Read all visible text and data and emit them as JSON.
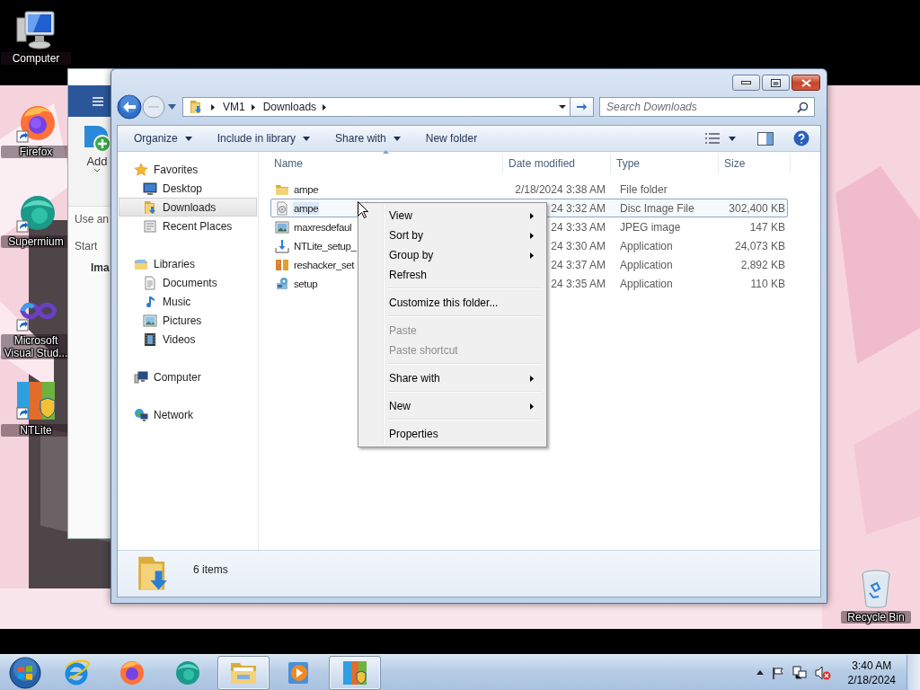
{
  "desktop": {
    "icons": [
      {
        "label": "Computer"
      },
      {
        "label": "Firefox"
      },
      {
        "label": "Supermium"
      },
      {
        "label": "Microsoft Visual Stud..."
      },
      {
        "label": "NTLite"
      },
      {
        "label": "Recycle Bin"
      }
    ]
  },
  "back_window": {
    "button": "Add",
    "texts": [
      "Use an",
      "Start",
      "Ima"
    ]
  },
  "explorer": {
    "address": {
      "crumbs": [
        "VM1",
        "Downloads"
      ]
    },
    "search": {
      "placeholder": "Search Downloads"
    },
    "commands": [
      {
        "label": "Organize",
        "dropdown": true
      },
      {
        "label": "Include in library",
        "dropdown": true
      },
      {
        "label": "Share with",
        "dropdown": true
      },
      {
        "label": "New folder",
        "dropdown": false
      }
    ],
    "nav": [
      {
        "label": "Favorites",
        "selected": false,
        "children": [
          {
            "label": "Desktop",
            "selected": false
          },
          {
            "label": "Downloads",
            "selected": true
          },
          {
            "label": "Recent Places",
            "selected": false
          }
        ]
      },
      {
        "label": "Libraries",
        "selected": false,
        "children": [
          {
            "label": "Documents",
            "selected": false
          },
          {
            "label": "Music",
            "selected": false
          },
          {
            "label": "Pictures",
            "selected": false
          },
          {
            "label": "Videos",
            "selected": false
          }
        ]
      },
      {
        "label": "Computer",
        "selected": false
      },
      {
        "label": "Network",
        "selected": false
      }
    ],
    "columns": [
      "Name",
      "Date modified",
      "Type",
      "Size"
    ],
    "files": [
      {
        "name": "ampe",
        "date": "2/18/2024 3:38 AM",
        "type": "File folder",
        "selected": false
      },
      {
        "name": "ampe",
        "date": "24 3:32 AM",
        "type": "Disc Image File",
        "size": "302,400 KB",
        "selected": true
      },
      {
        "name": "maxresdefaul",
        "date": "24 3:33 AM",
        "type": "JPEG image",
        "size": "147 KB",
        "selected": false
      },
      {
        "name": "NTLite_setup_",
        "date": "24 3:30 AM",
        "type": "Application",
        "size": "24,073 KB",
        "selected": false
      },
      {
        "name": "reshacker_set",
        "date": "24 3:37 AM",
        "type": "Application",
        "size": "2,892 KB",
        "selected": false
      },
      {
        "name": "setup",
        "date": "24 3:35 AM",
        "type": "Application",
        "size": "110 KB",
        "selected": false
      }
    ],
    "status": "6 items"
  },
  "context_menu": {
    "items": [
      {
        "kind": "item",
        "label": "View",
        "submenu": true,
        "disabled": false
      },
      {
        "kind": "item",
        "label": "Sort by",
        "submenu": true,
        "disabled": false
      },
      {
        "kind": "item",
        "label": "Group by",
        "submenu": true,
        "disabled": false
      },
      {
        "kind": "item",
        "label": "Refresh",
        "submenu": false,
        "disabled": false
      },
      {
        "kind": "separator"
      },
      {
        "kind": "item",
        "label": "Customize this folder...",
        "submenu": false,
        "disabled": false
      },
      {
        "kind": "separator"
      },
      {
        "kind": "item",
        "label": "Paste",
        "submenu": false,
        "disabled": true
      },
      {
        "kind": "item",
        "label": "Paste shortcut",
        "submenu": false,
        "disabled": true
      },
      {
        "kind": "separator"
      },
      {
        "kind": "item",
        "label": "Share with",
        "submenu": true,
        "disabled": false
      },
      {
        "kind": "separator"
      },
      {
        "kind": "item",
        "label": "New",
        "submenu": true,
        "disabled": false
      },
      {
        "kind": "separator"
      },
      {
        "kind": "item",
        "label": "Properties",
        "submenu": false,
        "disabled": false
      }
    ]
  },
  "taskbar": {
    "buttons": [
      {
        "open": false
      },
      {
        "open": false
      },
      {
        "open": false
      },
      {
        "open": true
      },
      {
        "open": false
      },
      {
        "open": true
      }
    ],
    "clock": {
      "time": "3:40 AM",
      "date": "2/18/2024"
    }
  }
}
